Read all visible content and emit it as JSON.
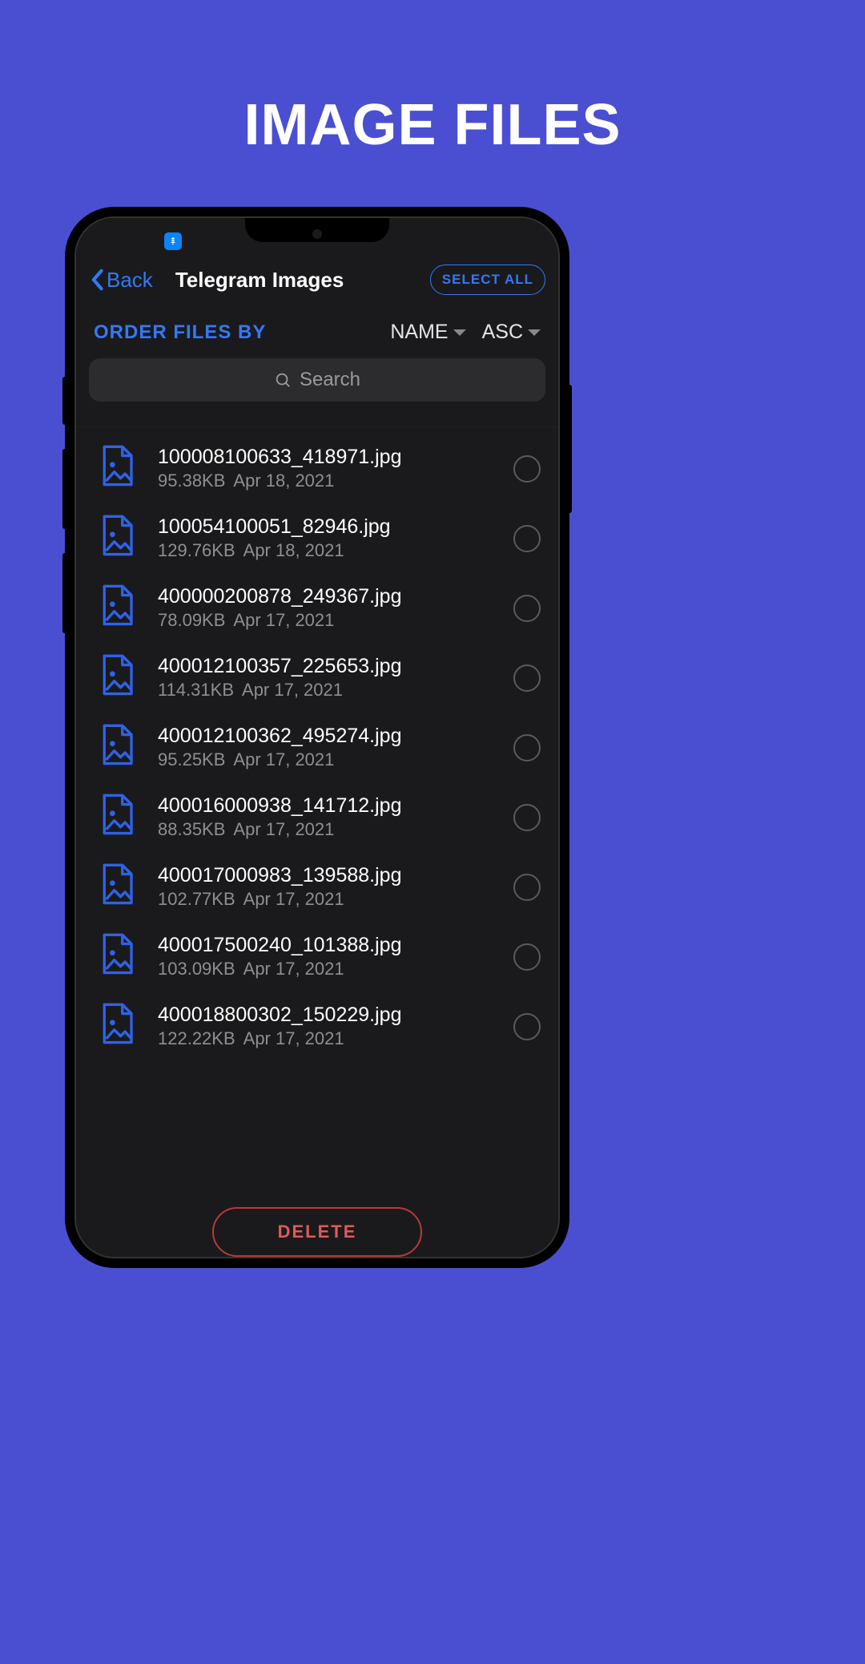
{
  "promo": {
    "title": "IMAGE FILES"
  },
  "nav": {
    "back_label": "Back",
    "title": "Telegram Images",
    "select_all_label": "SELECT ALL"
  },
  "sort": {
    "order_label": "ORDER FILES BY",
    "field": "NAME",
    "direction": "ASC"
  },
  "search": {
    "placeholder": "Search"
  },
  "files": [
    {
      "name": "100008100633_418971.jpg",
      "size": "95.38KB",
      "date": "Apr 18, 2021"
    },
    {
      "name": "100054100051_82946.jpg",
      "size": "129.76KB",
      "date": "Apr 18, 2021"
    },
    {
      "name": "400000200878_249367.jpg",
      "size": "78.09KB",
      "date": "Apr 17, 2021"
    },
    {
      "name": "400012100357_225653.jpg",
      "size": "114.31KB",
      "date": "Apr 17, 2021"
    },
    {
      "name": "400012100362_495274.jpg",
      "size": "95.25KB",
      "date": "Apr 17, 2021"
    },
    {
      "name": "400016000938_141712.jpg",
      "size": "88.35KB",
      "date": "Apr 17, 2021"
    },
    {
      "name": "400017000983_139588.jpg",
      "size": "102.77KB",
      "date": "Apr 17, 2021"
    },
    {
      "name": "400017500240_101388.jpg",
      "size": "103.09KB",
      "date": "Apr 17, 2021"
    },
    {
      "name": "400018800302_150229.jpg",
      "size": "122.22KB",
      "date": "Apr 17, 2021"
    }
  ],
  "actions": {
    "delete_label": "DELETE"
  }
}
